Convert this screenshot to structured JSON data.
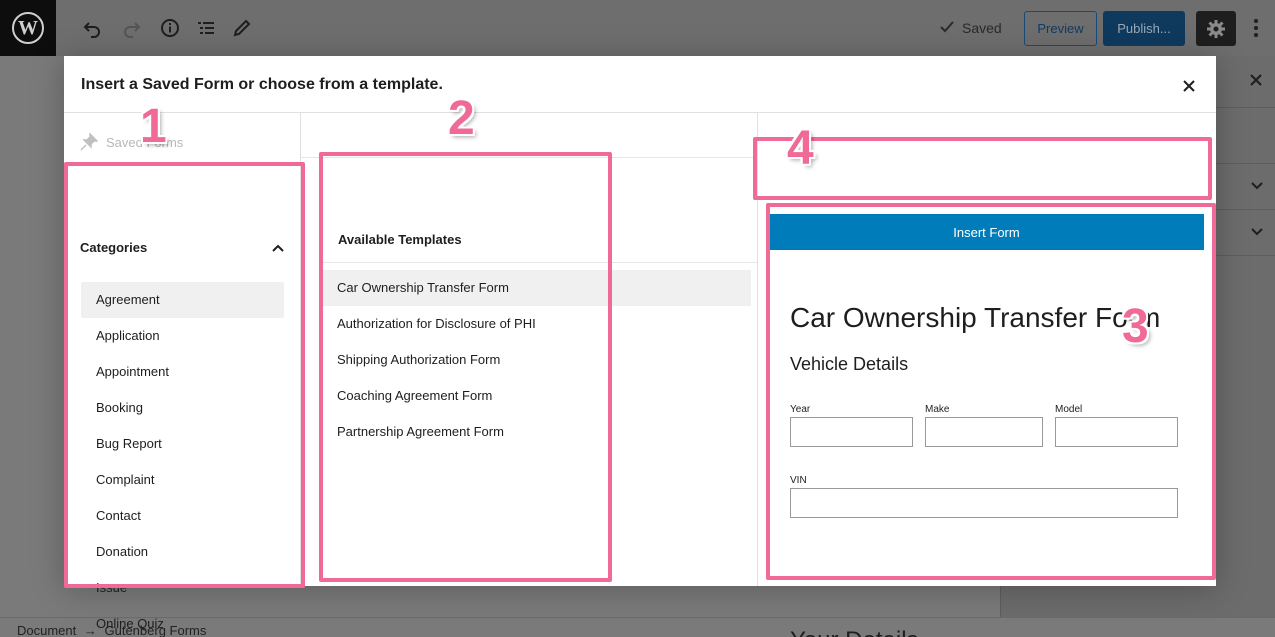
{
  "editor": {
    "saved_label": "Saved",
    "preview_label": "Preview",
    "publish_label": "Publish..."
  },
  "modal": {
    "title": "Insert a Saved Form or choose from a template.",
    "close_label": "×",
    "saved_forms_label": "Saved Forms",
    "categories": {
      "header": "Categories",
      "items": [
        "Agreement",
        "Application",
        "Appointment",
        "Booking",
        "Bug Report",
        "Complaint",
        "Contact",
        "Donation",
        "Issue",
        "Online Quiz"
      ],
      "selected": "Agreement"
    },
    "templates": {
      "header": "Available Templates",
      "items": [
        "Car Ownership Transfer Form",
        "Authorization for Disclosure of PHI",
        "Shipping Authorization Form",
        "Coaching Agreement Form",
        "Partnership Agreement Form"
      ],
      "selected": "Car Ownership Transfer Form"
    },
    "insert_button": "Insert Form",
    "preview": {
      "title": "Car Ownership Transfer Form",
      "section1": "Vehicle Details",
      "field_year": "Year",
      "field_make": "Make",
      "field_model": "Model",
      "field_vin": "VIN",
      "section2": "Your Details"
    }
  },
  "footer": {
    "breadcrumb_1": "Document",
    "breadcrumb_sep": "→",
    "breadcrumb_2": "Gutenberg Forms"
  },
  "annotations": [
    "1",
    "2",
    "3",
    "4"
  ],
  "colors": {
    "annotation": "#f06a98",
    "primary_button": "#007cba",
    "overlay": "#7a7a7a"
  }
}
